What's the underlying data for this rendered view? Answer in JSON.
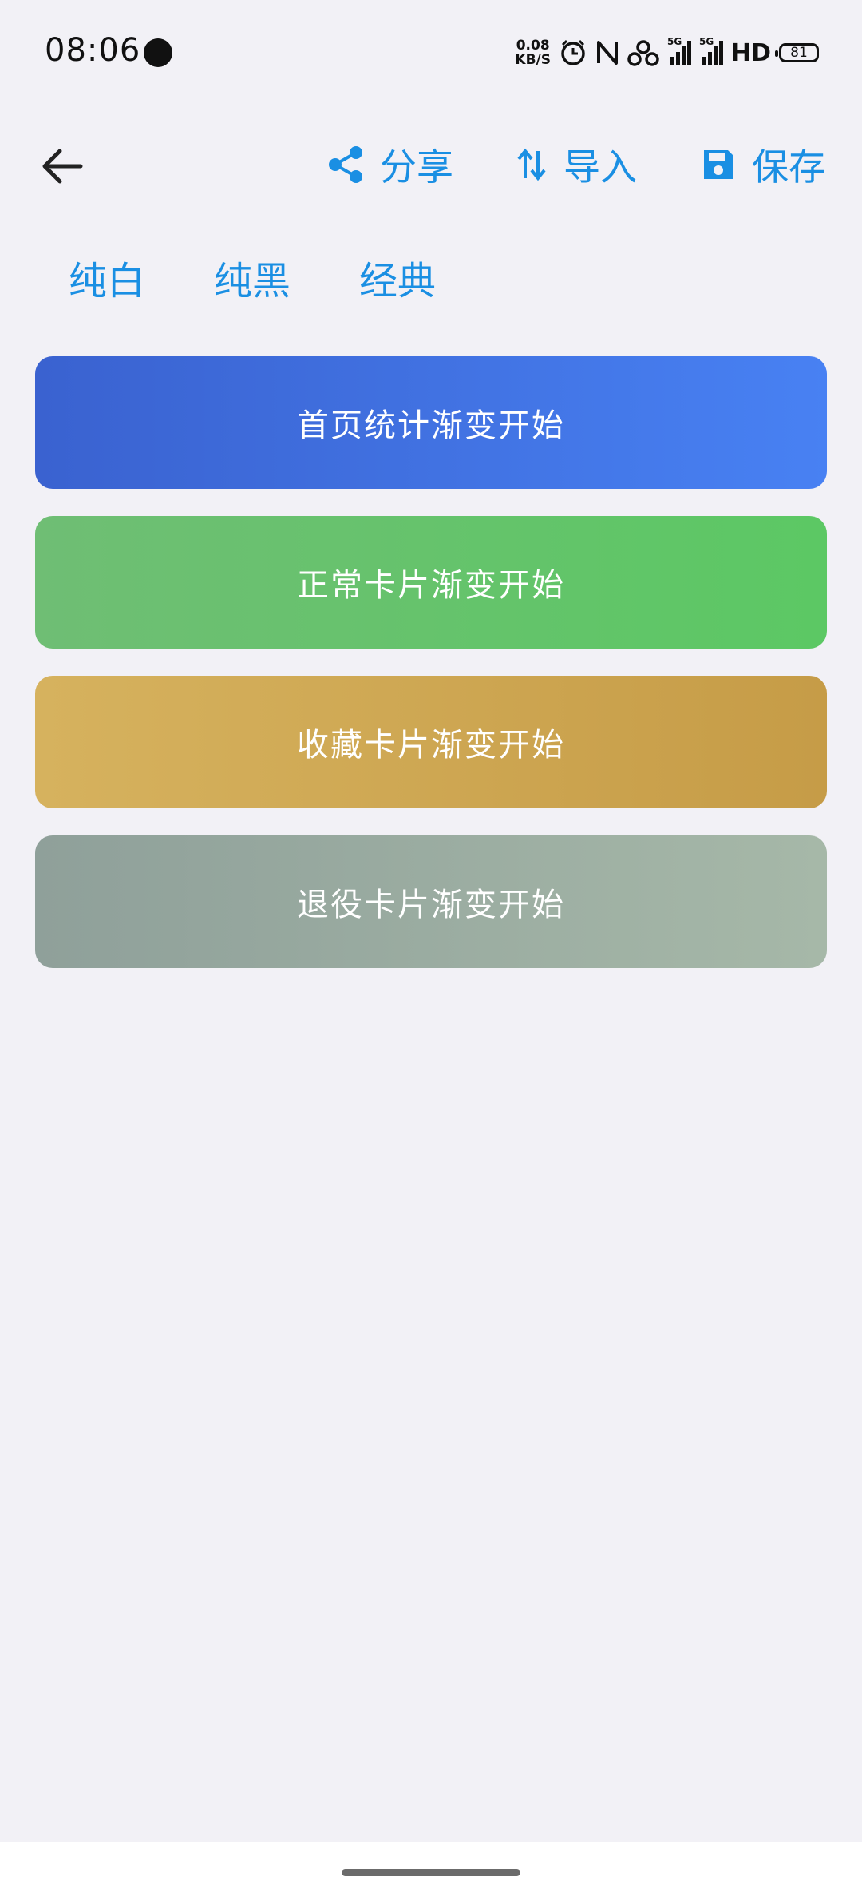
{
  "status_bar": {
    "time": "08:06",
    "net_speed_value": "0.08",
    "net_speed_unit": "KB/S",
    "sig1_label": "5G",
    "sig2_label": "5G",
    "hd_label": "HD",
    "battery": "81"
  },
  "toolbar": {
    "share_label": "分享",
    "import_label": "导入",
    "save_label": "保存",
    "accent_color": "#1a8fe3"
  },
  "presets": [
    "纯白",
    "纯黑",
    "经典"
  ],
  "cards": [
    {
      "label": "首页统计渐变开始",
      "color_start": "#3a62d0",
      "color_end": "#4881f3"
    },
    {
      "label": "正常卡片渐变开始",
      "color_start": "#6fbe74",
      "color_end": "#5cc864"
    },
    {
      "label": "收藏卡片渐变开始",
      "color_start": "#d6b25e",
      "color_end": "#c69c47"
    },
    {
      "label": "退役卡片渐变开始",
      "color_start": "#8fa09a",
      "color_end": "#a6b8a8"
    }
  ]
}
